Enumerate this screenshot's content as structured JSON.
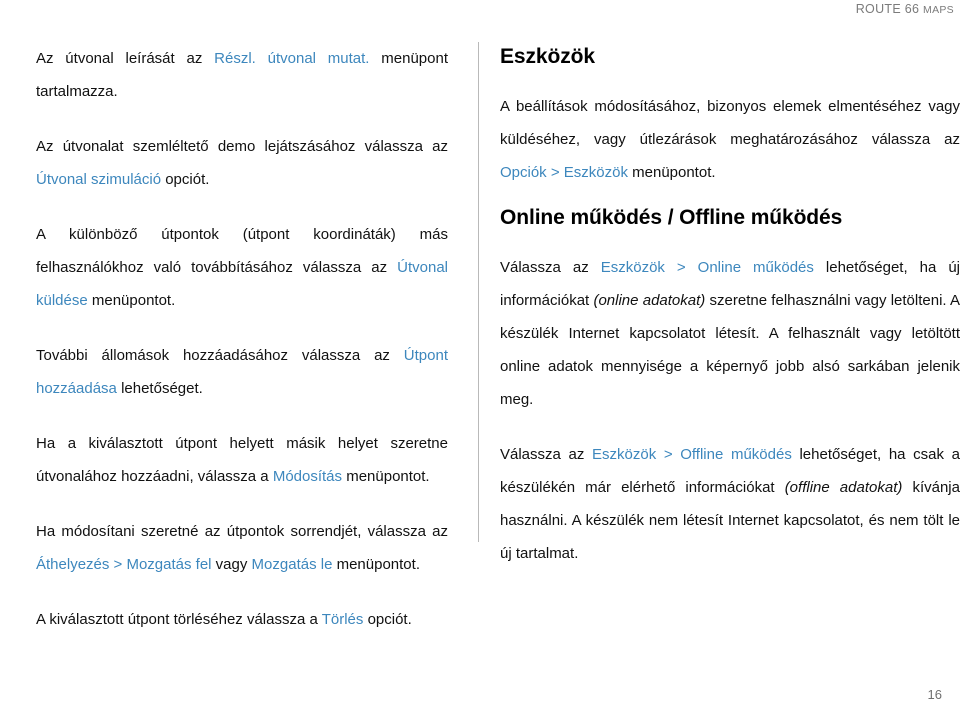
{
  "header": {
    "brand_main": "ROUTE 66 ",
    "brand_smallcaps": "MAPS"
  },
  "accent_color": "#3d87bd",
  "left_column": {
    "paragraphs": [
      {
        "id": "p-route-description",
        "runs": [
          {
            "text": "Az útvonal leírását az ",
            "style": "normal"
          },
          {
            "text": "Részl. útvonal mutat.",
            "style": "link"
          },
          {
            "text": " menüpont tartalmazza.",
            "style": "normal"
          }
        ]
      },
      {
        "id": "p-route-simulation",
        "runs": [
          {
            "text": "Az útvonalat szemléltető demo lejátszásához válassza az ",
            "style": "normal"
          },
          {
            "text": "Útvonal szimuláció",
            "style": "link"
          },
          {
            "text": " opciót.",
            "style": "normal"
          }
        ]
      },
      {
        "id": "p-send-route",
        "runs": [
          {
            "text": "A különböző útpontok (útpont koordináták) más felhasználókhoz való továbbításához válassza az ",
            "style": "normal"
          },
          {
            "text": "Útvonal küldése",
            "style": "link"
          },
          {
            "text": " menüpontot.",
            "style": "normal"
          }
        ]
      },
      {
        "id": "p-add-waypoint",
        "runs": [
          {
            "text": "További állomások hozzáadásához válassza az ",
            "style": "normal"
          },
          {
            "text": "Útpont hozzáadása",
            "style": "link"
          },
          {
            "text": " lehetőséget.",
            "style": "normal"
          }
        ]
      },
      {
        "id": "p-modify-waypoint",
        "runs": [
          {
            "text": "Ha a kiválasztott útpont helyett másik helyet szeretne útvonalához hozzáadni, válassza a ",
            "style": "normal"
          },
          {
            "text": "Módosítás",
            "style": "link"
          },
          {
            "text": " menüpontot.",
            "style": "normal"
          }
        ]
      },
      {
        "id": "p-reorder-waypoints",
        "runs": [
          {
            "text": "Ha módosítani szeretné az útpontok sorrendjét, válassza az ",
            "style": "normal"
          },
          {
            "text": "Áthelyezés > Mozgatás fel",
            "style": "link"
          },
          {
            "text": " vagy ",
            "style": "normal"
          },
          {
            "text": "Mozgatás le",
            "style": "link"
          },
          {
            "text": " menüpontot.",
            "style": "normal"
          }
        ]
      },
      {
        "id": "p-delete-waypoint",
        "runs": [
          {
            "text": "A kiválasztott útpont törléséhez válassza a ",
            "style": "normal"
          },
          {
            "text": "Törlés",
            "style": "link"
          },
          {
            "text": " opciót.",
            "style": "normal"
          }
        ]
      }
    ]
  },
  "right_column": {
    "heading_tools": "Eszközök",
    "heading_online_offline": "Online működés / Offline működés",
    "paragraphs_tools": [
      {
        "id": "p-tools-intro",
        "runs": [
          {
            "text": "A beállítások módosításához, bizonyos elemek elmentéséhez vagy küldéséhez, vagy útlezárások meghatározásához válassza az ",
            "style": "normal"
          },
          {
            "text": "Opciók > Eszközök",
            "style": "link"
          },
          {
            "text": " menüpontot.",
            "style": "normal"
          }
        ]
      }
    ],
    "paragraphs_online": [
      {
        "id": "p-online-mode",
        "runs": [
          {
            "text": "Válassza az ",
            "style": "normal"
          },
          {
            "text": "Eszközök > Online működés",
            "style": "link"
          },
          {
            "text": " lehetőséget, ha új információkat ",
            "style": "normal"
          },
          {
            "text": "(online adatokat)",
            "style": "italic"
          },
          {
            "text": " szeretne felhasználni vagy letölteni. A készülék Internet kapcsolatot létesít. A felhasznált vagy letöltött online adatok mennyisége a képernyő jobb alsó sarkában jelenik meg.",
            "style": "normal"
          }
        ]
      },
      {
        "id": "p-offline-mode",
        "runs": [
          {
            "text": "Válassza az ",
            "style": "normal"
          },
          {
            "text": "Eszközök > Offline működés",
            "style": "link"
          },
          {
            "text": " lehetőséget, ha csak a készülékén már elérhető információkat ",
            "style": "normal"
          },
          {
            "text": "(offline adatokat)",
            "style": "italic"
          },
          {
            "text": " kívánja használni. A készülék nem létesít Internet kapcsolatot, és nem tölt le új tartalmat.",
            "style": "normal"
          }
        ]
      }
    ]
  },
  "footer": {
    "page_number": "16"
  }
}
